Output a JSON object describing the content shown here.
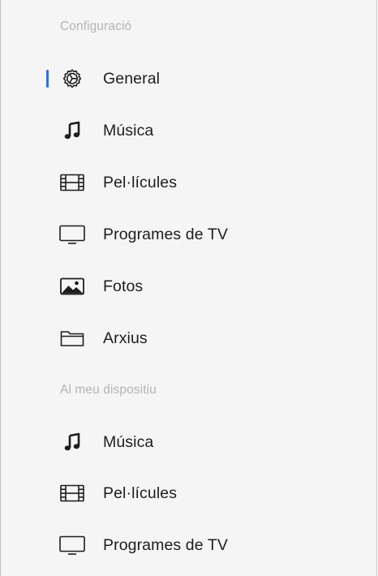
{
  "sections": [
    {
      "title": "Configuració",
      "items": [
        {
          "label": "General",
          "icon": "gear-icon",
          "selected": true
        },
        {
          "label": "Música",
          "icon": "music-note-icon"
        },
        {
          "label": "Pel·lícules",
          "icon": "film-icon"
        },
        {
          "label": "Programes de TV",
          "icon": "tv-icon"
        },
        {
          "label": "Fotos",
          "icon": "photo-icon"
        },
        {
          "label": "Arxius",
          "icon": "folder-icon"
        }
      ]
    },
    {
      "title": "Al meu dispositiu",
      "items": [
        {
          "label": "Música",
          "icon": "music-note-icon"
        },
        {
          "label": "Pel·lícules",
          "icon": "film-icon"
        },
        {
          "label": "Programes de TV",
          "icon": "tv-icon"
        }
      ]
    }
  ],
  "colors": {
    "accent": "#2f6fea",
    "text": "#1d1d1f",
    "section_title": "#b4b4b4",
    "background": "#f5f5f5"
  }
}
